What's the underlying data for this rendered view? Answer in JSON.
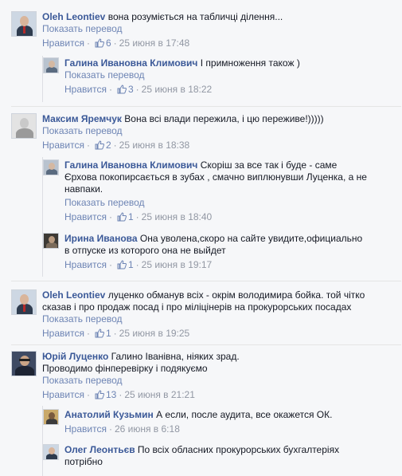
{
  "ui": {
    "like_label": "Нравится",
    "translate_label": "Показать перевод",
    "colors": {
      "author": "#3b5998",
      "link": "#6d84b4",
      "meta": "#9197a3",
      "text": "#141823",
      "background": "#f6f7f9"
    }
  },
  "comments": [
    {
      "author": "Oleh Leontiev",
      "text": "вона розуміється на табличці ділення...",
      "translate": "Показать перевод",
      "like": "Нравится",
      "likes": "6",
      "time": "25 июня в 17:48",
      "icon": "thumbs-up-icon"
    },
    {
      "author": "Галина Ивановна Климович",
      "text": "І примноження також )",
      "translate": "Показать перевод",
      "like": "Нравится",
      "likes": "3",
      "time": "25 июня в 18:22"
    },
    {
      "author": "Максим Яремчук",
      "text": "Вона всі влади пережила, і цю переживе!)))))",
      "translate": "Показать перевод",
      "like": "Нравится",
      "likes": "2",
      "time": "25 июня в 18:38"
    },
    {
      "author": "Галина Ивановна Климович",
      "text_line1": "Скоріш за все так і буде - саме",
      "text_line2": "Єрхова покопирсається в зубах , смачно виплюнувши Луценка, а не",
      "text_line3": "навпаки.",
      "translate": "Показать перевод",
      "like": "Нравится",
      "likes": "1",
      "time": "25 июня в 18:40"
    },
    {
      "author": "Ирина Иванова",
      "text_line1": "Она уволена,скоро на сайте увидите,официально",
      "text_line2": "в отпуске из которого она не выйдет",
      "like": "Нравится",
      "likes": "1",
      "time": "25 июня в 19:17"
    },
    {
      "author": "Oleh Leontiev",
      "text_line1": "луценко обманув всіх - окрім володимира бойка. той чітко",
      "text_line2": "сказав і про продаж посад і про міліцінерів на прокурорських посадах",
      "translate": "Показать перевод",
      "like": "Нравится",
      "likes": "1",
      "time": "25 июня в 19:25"
    },
    {
      "author": "Юрій Луценко",
      "text_line1": "Галино Іванівна, ніяких зрад.",
      "text_line2": "Проводимо фінперевірку і подякуємо",
      "translate": "Показать перевод",
      "like": "Нравится",
      "likes": "13",
      "time": "25 июня в 21:21"
    },
    {
      "author": "Анатолий Кузьмин",
      "text": "А если, после аудита, все окажется ОК.",
      "like": "Нравится",
      "time": "26 июня в 6:18"
    },
    {
      "author": "Олег Леонтьєв",
      "text_line1": "По всіх обласних прокурорських бухгалтеріях",
      "text_line2": "потрібно"
    }
  ]
}
